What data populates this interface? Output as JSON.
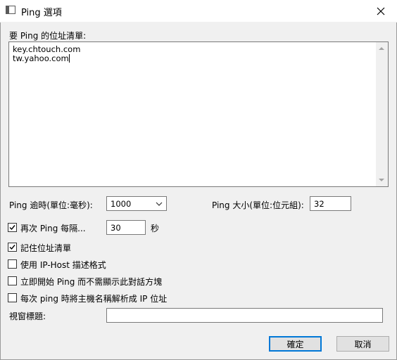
{
  "window": {
    "title": "Ping 選項"
  },
  "address_list": {
    "label": "要 Ping 的位址清單:",
    "lines": [
      "key.chtouch.com",
      "tw.yahoo.com"
    ]
  },
  "timeout": {
    "label": "Ping 逾時(單位:毫秒):",
    "value": "1000"
  },
  "size": {
    "label": "Ping 大小(單位:位元組):",
    "value": "32"
  },
  "repeat": {
    "label": "再次 Ping 每隔...",
    "checked": true,
    "value": "30",
    "unit": "秒"
  },
  "options": [
    {
      "label": "記住位址清單",
      "checked": true
    },
    {
      "label": "使用 IP-Host 描述格式",
      "checked": false
    },
    {
      "label": "立即開始 Ping 而不需顯示此對話方塊",
      "checked": false
    },
    {
      "label": "每次 ping 時將主機名稱解析成 IP 位址",
      "checked": false
    }
  ],
  "window_title_field": {
    "label": "視窗標題:",
    "value": ""
  },
  "buttons": {
    "ok": "確定",
    "cancel": "取消"
  },
  "icons": {
    "app": "window-icon",
    "close": "close-icon",
    "dropdown": "chevron-down-icon",
    "check": "checkmark-icon"
  },
  "colors": {
    "accent": "#0078d7",
    "background": "#f0f0f0",
    "field": "#ffffff"
  }
}
